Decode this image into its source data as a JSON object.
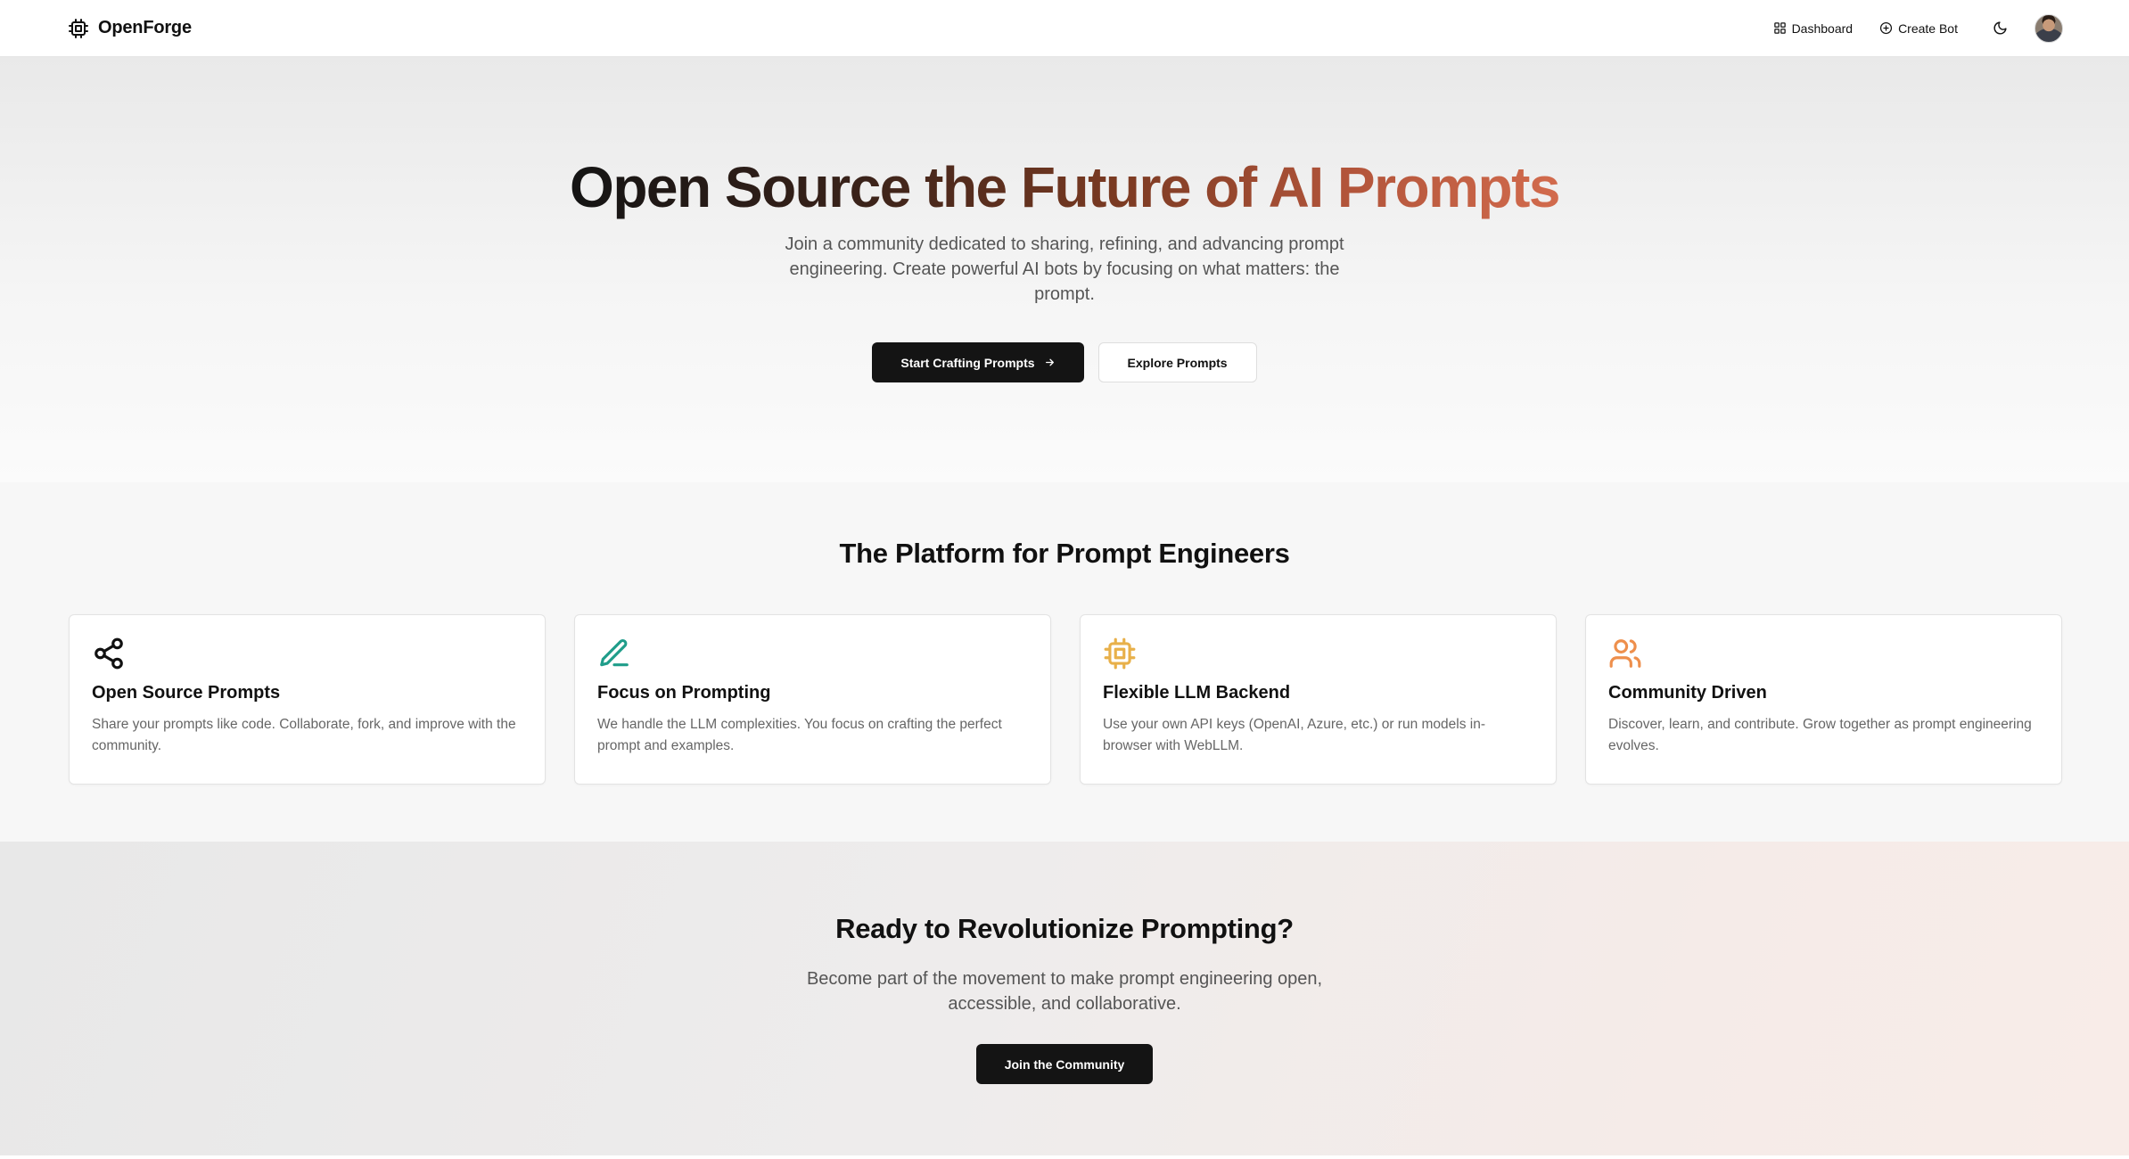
{
  "nav": {
    "brand": "OpenForge",
    "dashboard_label": "Dashboard",
    "create_bot_label": "Create Bot",
    "avatar_alt": "User avatar"
  },
  "hero": {
    "title": "Open Source the Future of AI Prompts",
    "subtitle": "Join a community dedicated to sharing, refining, and advancing prompt engineering. Create powerful AI bots by focusing on what matters: the prompt.",
    "primary_cta": "Start Crafting Prompts",
    "secondary_cta": "Explore Prompts",
    "gradient_colors": [
      "#141414",
      "#7a3a22",
      "#d26b4d"
    ]
  },
  "features": {
    "title": "The Platform for Prompt Engineers",
    "items": [
      {
        "icon": "share-icon",
        "icon_color": "#111111",
        "title": "Open Source Prompts",
        "description": "Share your prompts like code. Collaborate, fork, and improve with the community."
      },
      {
        "icon": "pen-icon",
        "icon_color": "#1f9d8a",
        "title": "Focus on Prompting",
        "description": "We handle the LLM complexities. You focus on crafting the perfect prompt and examples."
      },
      {
        "icon": "cpu-icon",
        "icon_color": "#e8b04a",
        "title": "Flexible LLM Backend",
        "description": "Use your own API keys (OpenAI, Azure, etc.) or run models in-browser with WebLLM."
      },
      {
        "icon": "users-icon",
        "icon_color": "#ee8f4c",
        "title": "Community Driven",
        "description": "Discover, learn, and contribute. Grow together as prompt engineering evolves."
      }
    ]
  },
  "cta": {
    "title": "Ready to Revolutionize Prompting?",
    "subtitle": "Become part of the movement to make prompt engineering open, accessible, and collaborative.",
    "button": "Join the Community"
  }
}
